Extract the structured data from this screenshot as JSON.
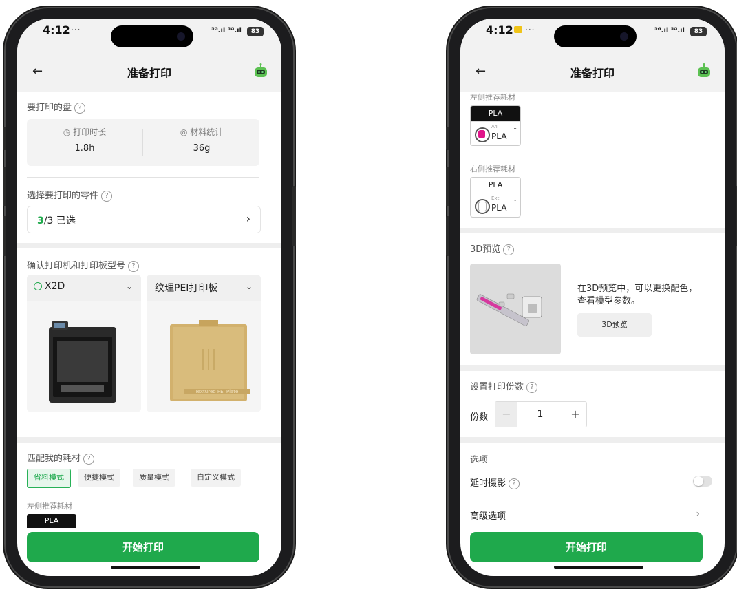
{
  "left": {
    "status": {
      "time": "4:12",
      "dots": "···",
      "signal": "⁵ᴳ.ıl ⁵ᴳ.ıl",
      "battery": "83"
    },
    "nav": {
      "back": "←",
      "title": "准备打印"
    },
    "plate_section": {
      "title": "要打印的盘",
      "print_time_label": "打印时长",
      "print_time_value": "1.8h",
      "material_label": "材料统计",
      "material_value": "36g"
    },
    "parts_section": {
      "title": "选择要打印的零件",
      "selected_count": "3",
      "selected_total": "/3 已选",
      "chevron": "›"
    },
    "printer_section": {
      "title": "确认打印机和打印板型号",
      "printer_name": "X2D",
      "plate_name": "纹理PEI打印板",
      "plate_image_label": "Textured PEI Plate",
      "chevron": "⌄"
    },
    "filament_section": {
      "title": "匹配我的耗材",
      "modes": [
        "省料模式",
        "便捷模式",
        "质量模式",
        "自定义模式"
      ],
      "active_mode_index": 0,
      "left_recommend_label": "左侧推荐耗材",
      "left_filament": "PLA"
    },
    "cta": "开始打印"
  },
  "right": {
    "status": {
      "time": "4:12",
      "dots": "···",
      "signal": "⁵ᴳ.ıl ⁵ᴳ.ıl",
      "battery": "83"
    },
    "nav": {
      "back": "←",
      "title": "准备打印"
    },
    "left_recommend_label": "左侧推荐耗材",
    "left_filament": {
      "head": "PLA",
      "slot": "A4",
      "type": "PLA",
      "spool_color": "#e0158a"
    },
    "right_recommend_label": "右侧推荐耗材",
    "right_filament": {
      "head": "PLA",
      "slot": "Ext.",
      "type": "PLA",
      "spool_color": "#ffffff"
    },
    "preview_section": {
      "title": "3D预览",
      "desc": "在3D预览中，可以更换配色，查看模型参数。",
      "button": "3D预览"
    },
    "copies_section": {
      "title": "设置打印份数",
      "label": "份数",
      "minus": "−",
      "value": "1",
      "plus": "+"
    },
    "options_section": {
      "title": "选项",
      "timelapse_label": "延时摄影",
      "timelapse_on": false,
      "advanced_label": "高级选项",
      "chevron": "›"
    },
    "cta": "开始打印"
  },
  "colors": {
    "accent": "#1fa94c",
    "magenta": "#e0158a",
    "robot": "#5cc152"
  }
}
